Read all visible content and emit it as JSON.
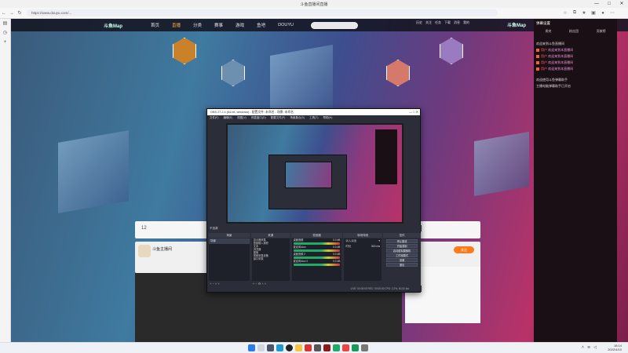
{
  "browser": {
    "title": "斗鱼直播间直播",
    "url": "https://www.douyu.com/...",
    "controls": [
      "—",
      "□",
      "✕"
    ]
  },
  "site": {
    "logo": "斗鱼Map",
    "logo2": "斗鱼Map",
    "nav": [
      "首页",
      "直播",
      "分类",
      "赛事",
      "游戏",
      "鱼吧",
      "DOUYU"
    ],
    "active_index": 1,
    "nav_icons": [
      "历史",
      "关注",
      "任务",
      "下载",
      "消息",
      "我的"
    ]
  },
  "chat": {
    "header": "弹幕设置",
    "tabs": [
      "贵宾",
      "粉丝团",
      "贡献榜"
    ],
    "lines": [
      {
        "name": "用户",
        "text": "欢迎来到本直播间"
      },
      {
        "name": "用户",
        "text": "欢迎来到本直播间"
      },
      {
        "name": "用户",
        "text": "欢迎来到本直播间"
      },
      {
        "name": "用户",
        "text": "欢迎来到本直播间"
      }
    ],
    "notice1": "欢迎使用斗鱼弹幕助手",
    "notice2": "主播电脑弹幕助手已开启",
    "notice3": "欢迎来到斗鱼直播间"
  },
  "room": {
    "streamer": "斗鱼主播间",
    "follow_label": "关注",
    "level": "12"
  },
  "obs": {
    "title": "OBS 27.2.4 (64-bit, windows) - 配置文件: 未命名 - 场景: 未命名",
    "menu": [
      "文件(F)",
      "编辑(E)",
      "视图(V)",
      "停靠窗口(D)",
      "配置文件(P)",
      "场景集合(S)",
      "工具(T)",
      "帮助(H)"
    ],
    "scene_label": "不选源",
    "docks": {
      "scenes": "场景",
      "sources": "来源",
      "mixer": "混音器",
      "transitions": "转场特效",
      "controls": "控件"
    },
    "scene_items": [
      "场景"
    ],
    "source_items": [
      "显示器采集",
      "音频输入捕获",
      "文本",
      "浏览器",
      "图像",
      "视频采集设备",
      "窗口采集"
    ],
    "mixer_items": [
      {
        "name": "桌面音频",
        "db": "0.0 dB"
      },
      {
        "name": "麦克风/Aux",
        "db": "0.0 dB"
      },
      {
        "name": "桌面音频 2",
        "db": "0.0 dB"
      },
      {
        "name": "麦克风/Aux 2",
        "db": "0.0 dB"
      }
    ],
    "transition": "淡入淡出",
    "duration_label": "时长",
    "duration": "300 ms",
    "control_buttons": [
      "停止推流",
      "开始录制",
      "启动虚拟摄像机",
      "工作室模式",
      "设置",
      "退出"
    ],
    "status": "LIVE: 00:00:00   REC: 00:00:00   CPU: 2.2%, 60.00 fps"
  },
  "taskbar": {
    "time": "18:14",
    "date": "2022/4/10"
  }
}
